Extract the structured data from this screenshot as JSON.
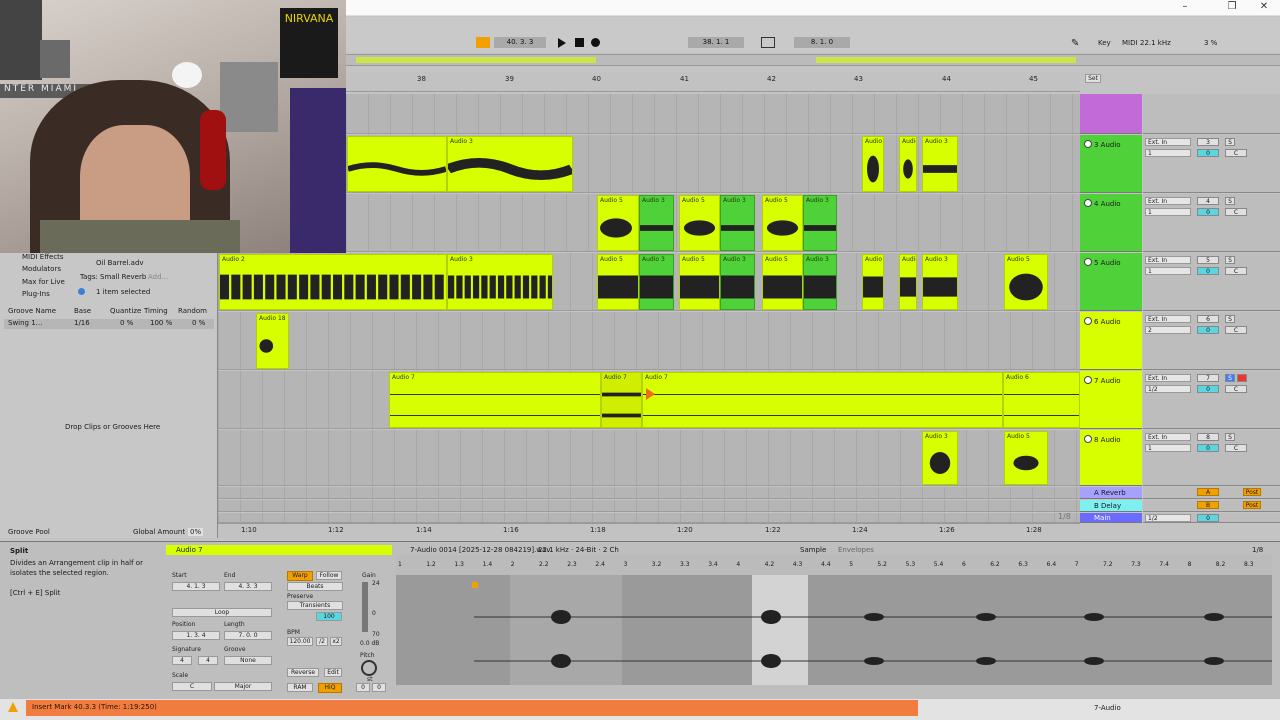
{
  "window": {
    "minimize": "–",
    "restore": "❐",
    "close": "✕"
  },
  "transport": {
    "position": "40.  3.  3",
    "loop_start": "38.  1.  1",
    "loop_length": "8.  1.  0",
    "key_label": "Key",
    "midi_label": "MIDI",
    "sample_rate": "22.1 kHz",
    "cpu": "3 %"
  },
  "ruler": {
    "bars": [
      "38",
      "39",
      "40",
      "41",
      "42",
      "43",
      "44",
      "45"
    ]
  },
  "time_ruler": {
    "times": [
      "1:10",
      "1:12",
      "1:14",
      "1:16",
      "1:18",
      "1:20",
      "1:22",
      "1:24",
      "1:26",
      "1:28"
    ],
    "grid": "1/8"
  },
  "tracks": [
    {
      "name": "3 Audio",
      "input": "Ext. In",
      "channel": "1",
      "num": "3",
      "vol": "0",
      "pan": "C"
    },
    {
      "name": "4 Audio",
      "input": "Ext. In",
      "channel": "1",
      "num": "4",
      "vol": "0",
      "pan": "C"
    },
    {
      "name": "5 Audio",
      "input": "Ext. In",
      "channel": "1",
      "num": "5",
      "vol": "0",
      "pan": "C"
    },
    {
      "name": "6 Audio",
      "input": "Ext. In",
      "channel": "2",
      "num": "6",
      "vol": "0",
      "pan": "C"
    },
    {
      "name": "7 Audio",
      "input": "Ext. In",
      "channel": "1/2",
      "num": "7",
      "vol": "0",
      "pan": "C"
    },
    {
      "name": "8 Audio",
      "input": "Ext. In",
      "channel": "1",
      "num": "8",
      "vol": "0",
      "pan": "C"
    }
  ],
  "returns": [
    {
      "name": "A Reverb",
      "letter": "A",
      "post": "Post"
    },
    {
      "name": "B Delay",
      "letter": "B",
      "post": "Post"
    },
    {
      "name": "Main",
      "channel": "1/2",
      "vol": "0",
      "post": "Post"
    }
  ],
  "io_labels": {
    "in": "In",
    "auto": "Auto",
    "off": "Off",
    "main": "Main",
    "s": "S",
    "set": "Set"
  },
  "clips": {
    "audio3": "Audio 3",
    "audio2": "Audio 2",
    "audio5": "Audio 5",
    "audio18": "Audio 18",
    "audio7": "Audio 7",
    "audio6": "Audio 6"
  },
  "browser": {
    "items": [
      "MIDI Effects",
      "Modulators",
      "Max for Live",
      "Plug-Ins"
    ],
    "file": "Oil Barrel.adv",
    "tags_label": "Tags:",
    "tag": "Small Reverb",
    "add": "Add...",
    "selected": "1 item selected"
  },
  "groove": {
    "headers": [
      "Groove Name",
      "Base",
      "Quantize",
      "Timing",
      "Random"
    ],
    "row": {
      "name": "Swing 1...",
      "base": "1/16",
      "quantize": "0 %",
      "timing": "100 %",
      "random": "0 %"
    },
    "drop": "Drop Clips or Grooves Here",
    "pool": "Groove Pool",
    "global_label": "Global Amount",
    "global_value": "0%"
  },
  "info": {
    "title": "Split",
    "desc": "Divides an Arrangement clip in half or isolates the selected region.",
    "shortcut": "[Ctrl + E] Split"
  },
  "clip_panel": {
    "name": "Audio 7",
    "start_label": "Start",
    "end_label": "End",
    "set": "Set",
    "start": "4.  1.  3",
    "end": "4.  3.  3",
    "loop": "Loop",
    "position_label": "Position",
    "length_label": "Length",
    "position": "1.  3.  4",
    "length": "7.  0.  0",
    "signature_label": "Signature",
    "sig_num": "4",
    "sig_den": "4",
    "groove_label": "Groove",
    "groove": "None",
    "scale_label": "Scale",
    "scale_root": "C",
    "scale_mode": "Major",
    "warp": "Warp",
    "follow": "Follow",
    "beats": "Beats",
    "preserve": "Preserve",
    "transients": "Transients",
    "warp_amount": "100",
    "bpm_label": "BPM",
    "bpm": "120.00",
    "half": "/2",
    "double": "x2",
    "reverse": "Reverse",
    "edit": "Edit",
    "ram": "RAM",
    "hiq": "HiQ",
    "gain_label": "Gain",
    "gain_top": "24",
    "gain_zero": "0",
    "gain_bottom": "70",
    "gain_value": "0.0 dB",
    "pitch_label": "Pitch",
    "pitch_unit": "st",
    "pitch_a": "0",
    "pitch_b": "0"
  },
  "sample_view": {
    "file": "7-Audio 0014 [2025-12-28 084219].wav",
    "info": "22.1 kHz · 24-Bit · 2 Ch",
    "tab_sample": "Sample",
    "tab_env": "Envelopes",
    "grid": "1/8",
    "ticks": [
      "1",
      "1.2",
      "1.3",
      "1.4",
      "2",
      "2.2",
      "2.3",
      "2.4",
      "3",
      "3.2",
      "3.3",
      "3.4",
      "4",
      "4.2",
      "4.3",
      "4.4",
      "5",
      "5.2",
      "5.3",
      "5.4",
      "6",
      "6.2",
      "6.3",
      "6.4",
      "7",
      "7.2",
      "7.3",
      "7.4",
      "8",
      "8.2",
      "8.3"
    ]
  },
  "statusbar": {
    "message": "Insert Mark 40.3.3 (Time: 1:19:250)",
    "track": "7-Audio"
  },
  "colors": {
    "clip": "#d8ff00",
    "clip_selected": "#4fd13a",
    "orange": "#f2a000",
    "status": "#f07d3f"
  },
  "icons": [
    "play-icon",
    "stop-icon",
    "record-icon",
    "pencil-icon",
    "warning-icon",
    "fold-icon"
  ]
}
